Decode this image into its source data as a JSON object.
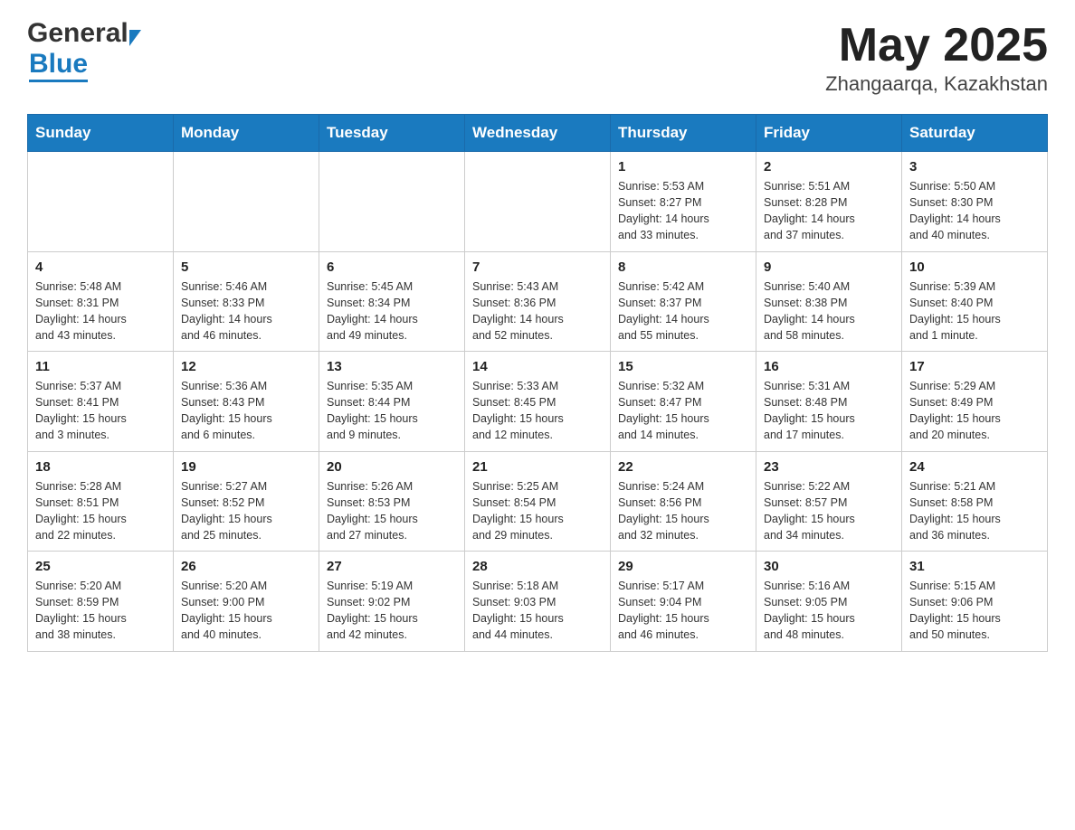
{
  "header": {
    "title": "May 2025",
    "subtitle": "Zhangaarqa, Kazakhstan",
    "logo_general": "General",
    "logo_blue": "Blue"
  },
  "weekdays": [
    "Sunday",
    "Monday",
    "Tuesday",
    "Wednesday",
    "Thursday",
    "Friday",
    "Saturday"
  ],
  "weeks": [
    [
      {
        "day": "",
        "info": ""
      },
      {
        "day": "",
        "info": ""
      },
      {
        "day": "",
        "info": ""
      },
      {
        "day": "",
        "info": ""
      },
      {
        "day": "1",
        "info": "Sunrise: 5:53 AM\nSunset: 8:27 PM\nDaylight: 14 hours\nand 33 minutes."
      },
      {
        "day": "2",
        "info": "Sunrise: 5:51 AM\nSunset: 8:28 PM\nDaylight: 14 hours\nand 37 minutes."
      },
      {
        "day": "3",
        "info": "Sunrise: 5:50 AM\nSunset: 8:30 PM\nDaylight: 14 hours\nand 40 minutes."
      }
    ],
    [
      {
        "day": "4",
        "info": "Sunrise: 5:48 AM\nSunset: 8:31 PM\nDaylight: 14 hours\nand 43 minutes."
      },
      {
        "day": "5",
        "info": "Sunrise: 5:46 AM\nSunset: 8:33 PM\nDaylight: 14 hours\nand 46 minutes."
      },
      {
        "day": "6",
        "info": "Sunrise: 5:45 AM\nSunset: 8:34 PM\nDaylight: 14 hours\nand 49 minutes."
      },
      {
        "day": "7",
        "info": "Sunrise: 5:43 AM\nSunset: 8:36 PM\nDaylight: 14 hours\nand 52 minutes."
      },
      {
        "day": "8",
        "info": "Sunrise: 5:42 AM\nSunset: 8:37 PM\nDaylight: 14 hours\nand 55 minutes."
      },
      {
        "day": "9",
        "info": "Sunrise: 5:40 AM\nSunset: 8:38 PM\nDaylight: 14 hours\nand 58 minutes."
      },
      {
        "day": "10",
        "info": "Sunrise: 5:39 AM\nSunset: 8:40 PM\nDaylight: 15 hours\nand 1 minute."
      }
    ],
    [
      {
        "day": "11",
        "info": "Sunrise: 5:37 AM\nSunset: 8:41 PM\nDaylight: 15 hours\nand 3 minutes."
      },
      {
        "day": "12",
        "info": "Sunrise: 5:36 AM\nSunset: 8:43 PM\nDaylight: 15 hours\nand 6 minutes."
      },
      {
        "day": "13",
        "info": "Sunrise: 5:35 AM\nSunset: 8:44 PM\nDaylight: 15 hours\nand 9 minutes."
      },
      {
        "day": "14",
        "info": "Sunrise: 5:33 AM\nSunset: 8:45 PM\nDaylight: 15 hours\nand 12 minutes."
      },
      {
        "day": "15",
        "info": "Sunrise: 5:32 AM\nSunset: 8:47 PM\nDaylight: 15 hours\nand 14 minutes."
      },
      {
        "day": "16",
        "info": "Sunrise: 5:31 AM\nSunset: 8:48 PM\nDaylight: 15 hours\nand 17 minutes."
      },
      {
        "day": "17",
        "info": "Sunrise: 5:29 AM\nSunset: 8:49 PM\nDaylight: 15 hours\nand 20 minutes."
      }
    ],
    [
      {
        "day": "18",
        "info": "Sunrise: 5:28 AM\nSunset: 8:51 PM\nDaylight: 15 hours\nand 22 minutes."
      },
      {
        "day": "19",
        "info": "Sunrise: 5:27 AM\nSunset: 8:52 PM\nDaylight: 15 hours\nand 25 minutes."
      },
      {
        "day": "20",
        "info": "Sunrise: 5:26 AM\nSunset: 8:53 PM\nDaylight: 15 hours\nand 27 minutes."
      },
      {
        "day": "21",
        "info": "Sunrise: 5:25 AM\nSunset: 8:54 PM\nDaylight: 15 hours\nand 29 minutes."
      },
      {
        "day": "22",
        "info": "Sunrise: 5:24 AM\nSunset: 8:56 PM\nDaylight: 15 hours\nand 32 minutes."
      },
      {
        "day": "23",
        "info": "Sunrise: 5:22 AM\nSunset: 8:57 PM\nDaylight: 15 hours\nand 34 minutes."
      },
      {
        "day": "24",
        "info": "Sunrise: 5:21 AM\nSunset: 8:58 PM\nDaylight: 15 hours\nand 36 minutes."
      }
    ],
    [
      {
        "day": "25",
        "info": "Sunrise: 5:20 AM\nSunset: 8:59 PM\nDaylight: 15 hours\nand 38 minutes."
      },
      {
        "day": "26",
        "info": "Sunrise: 5:20 AM\nSunset: 9:00 PM\nDaylight: 15 hours\nand 40 minutes."
      },
      {
        "day": "27",
        "info": "Sunrise: 5:19 AM\nSunset: 9:02 PM\nDaylight: 15 hours\nand 42 minutes."
      },
      {
        "day": "28",
        "info": "Sunrise: 5:18 AM\nSunset: 9:03 PM\nDaylight: 15 hours\nand 44 minutes."
      },
      {
        "day": "29",
        "info": "Sunrise: 5:17 AM\nSunset: 9:04 PM\nDaylight: 15 hours\nand 46 minutes."
      },
      {
        "day": "30",
        "info": "Sunrise: 5:16 AM\nSunset: 9:05 PM\nDaylight: 15 hours\nand 48 minutes."
      },
      {
        "day": "31",
        "info": "Sunrise: 5:15 AM\nSunset: 9:06 PM\nDaylight: 15 hours\nand 50 minutes."
      }
    ]
  ]
}
